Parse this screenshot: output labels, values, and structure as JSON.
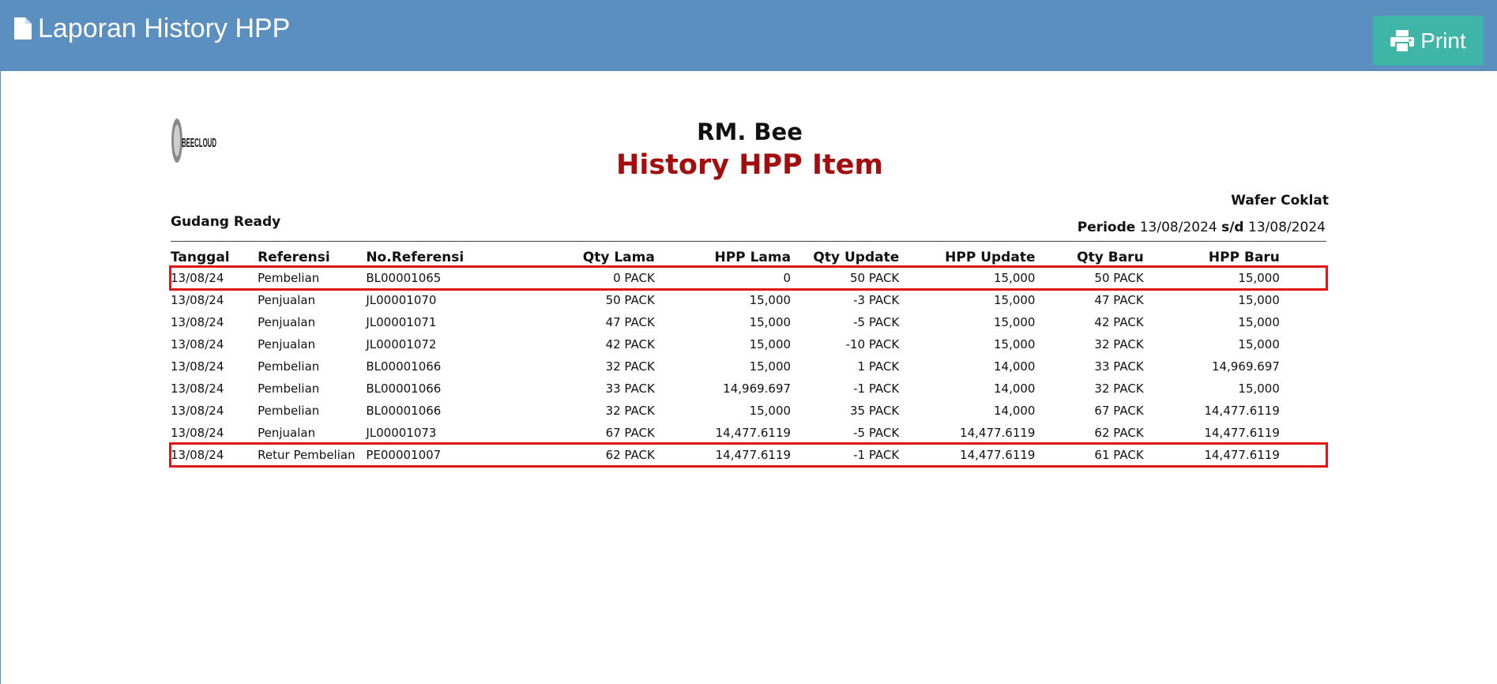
{
  "header": {
    "title": "Laporan History HPP",
    "print_label": "Print",
    "title_icon": "file-icon",
    "print_icon": "printer-icon"
  },
  "report": {
    "logo_text": "BEECLOUD",
    "company": "RM. Bee",
    "title": "History HPP Item",
    "item_name": "Wafer Coklat",
    "warehouse": "Gudang Ready",
    "periode_label": "Periode",
    "periode_from": "13/08/2024",
    "periode_sep": "s/d",
    "periode_to": "13/08/2024"
  },
  "table": {
    "columns": [
      "Tanggal",
      "Referensi",
      "No.Referensi",
      "Qty Lama",
      "HPP Lama",
      "Qty Update",
      "HPP Update",
      "Qty Baru",
      "HPP Baru"
    ],
    "rows": [
      {
        "tanggal": "13/08/24",
        "referensi": "Pembelian",
        "no_ref": "BL00001065",
        "qty_lama": "0 PACK",
        "hpp_lama": "0",
        "qty_update": "50 PACK",
        "hpp_update": "15,000",
        "qty_baru": "50 PACK",
        "hpp_baru": "15,000",
        "highlighted": true
      },
      {
        "tanggal": "13/08/24",
        "referensi": "Penjualan",
        "no_ref": "JL00001070",
        "qty_lama": "50 PACK",
        "hpp_lama": "15,000",
        "qty_update": "-3 PACK",
        "hpp_update": "15,000",
        "qty_baru": "47 PACK",
        "hpp_baru": "15,000",
        "highlighted": false
      },
      {
        "tanggal": "13/08/24",
        "referensi": "Penjualan",
        "no_ref": "JL00001071",
        "qty_lama": "47 PACK",
        "hpp_lama": "15,000",
        "qty_update": "-5 PACK",
        "hpp_update": "15,000",
        "qty_baru": "42 PACK",
        "hpp_baru": "15,000",
        "highlighted": false
      },
      {
        "tanggal": "13/08/24",
        "referensi": "Penjualan",
        "no_ref": "JL00001072",
        "qty_lama": "42 PACK",
        "hpp_lama": "15,000",
        "qty_update": "-10 PACK",
        "hpp_update": "15,000",
        "qty_baru": "32 PACK",
        "hpp_baru": "15,000",
        "highlighted": false
      },
      {
        "tanggal": "13/08/24",
        "referensi": "Pembelian",
        "no_ref": "BL00001066",
        "qty_lama": "32 PACK",
        "hpp_lama": "15,000",
        "qty_update": "1 PACK",
        "hpp_update": "14,000",
        "qty_baru": "33 PACK",
        "hpp_baru": "14,969.697",
        "highlighted": false
      },
      {
        "tanggal": "13/08/24",
        "referensi": "Pembelian",
        "no_ref": "BL00001066",
        "qty_lama": "33 PACK",
        "hpp_lama": "14,969.697",
        "qty_update": "-1 PACK",
        "hpp_update": "14,000",
        "qty_baru": "32 PACK",
        "hpp_baru": "15,000",
        "highlighted": false
      },
      {
        "tanggal": "13/08/24",
        "referensi": "Pembelian",
        "no_ref": "BL00001066",
        "qty_lama": "32 PACK",
        "hpp_lama": "15,000",
        "qty_update": "35 PACK",
        "hpp_update": "14,000",
        "qty_baru": "67 PACK",
        "hpp_baru": "14,477.6119",
        "highlighted": false
      },
      {
        "tanggal": "13/08/24",
        "referensi": "Penjualan",
        "no_ref": "JL00001073",
        "qty_lama": "67 PACK",
        "hpp_lama": "14,477.6119",
        "qty_update": "-5 PACK",
        "hpp_update": "14,477.6119",
        "qty_baru": "62 PACK",
        "hpp_baru": "14,477.6119",
        "highlighted": false
      },
      {
        "tanggal": "13/08/24",
        "referensi": "Retur Pembelian",
        "no_ref": "PE00001007",
        "qty_lama": "62 PACK",
        "hpp_lama": "14,477.6119",
        "qty_update": "-1 PACK",
        "hpp_update": "14,477.6119",
        "qty_baru": "61 PACK",
        "hpp_baru": "14,477.6119",
        "highlighted": true
      }
    ]
  },
  "colors": {
    "header_bg": "#5b8fbf",
    "print_button": "#3fb5a7",
    "title_red": "#a30d0d",
    "highlight_border": "#e01616"
  }
}
